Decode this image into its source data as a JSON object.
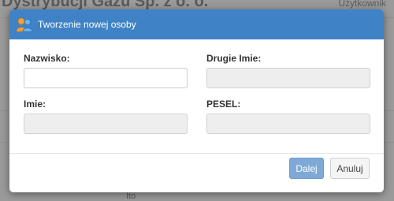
{
  "background": {
    "title": "Dystrybucji Gazu Sp. z o. o.",
    "user_label": "Użytkownik",
    "bottom_text": "Ito"
  },
  "dialog": {
    "title": "Tworzenie nowej osoby",
    "icon": "people-icon",
    "fields": {
      "nazwisko": {
        "label": "Nazwisko:",
        "value": "",
        "enabled": true
      },
      "drugie_imie": {
        "label": "Drugie Imie:",
        "value": "",
        "enabled": false
      },
      "imie": {
        "label": "Imie:",
        "value": "",
        "enabled": false
      },
      "pesel": {
        "label": "PESEL:",
        "value": "",
        "enabled": false
      }
    },
    "buttons": {
      "next": "Dalej",
      "cancel": "Anuluj"
    }
  },
  "colors": {
    "header": "#3f83c6",
    "primary_button": "#7ea9d6",
    "disabled_input": "#eeeeee"
  }
}
